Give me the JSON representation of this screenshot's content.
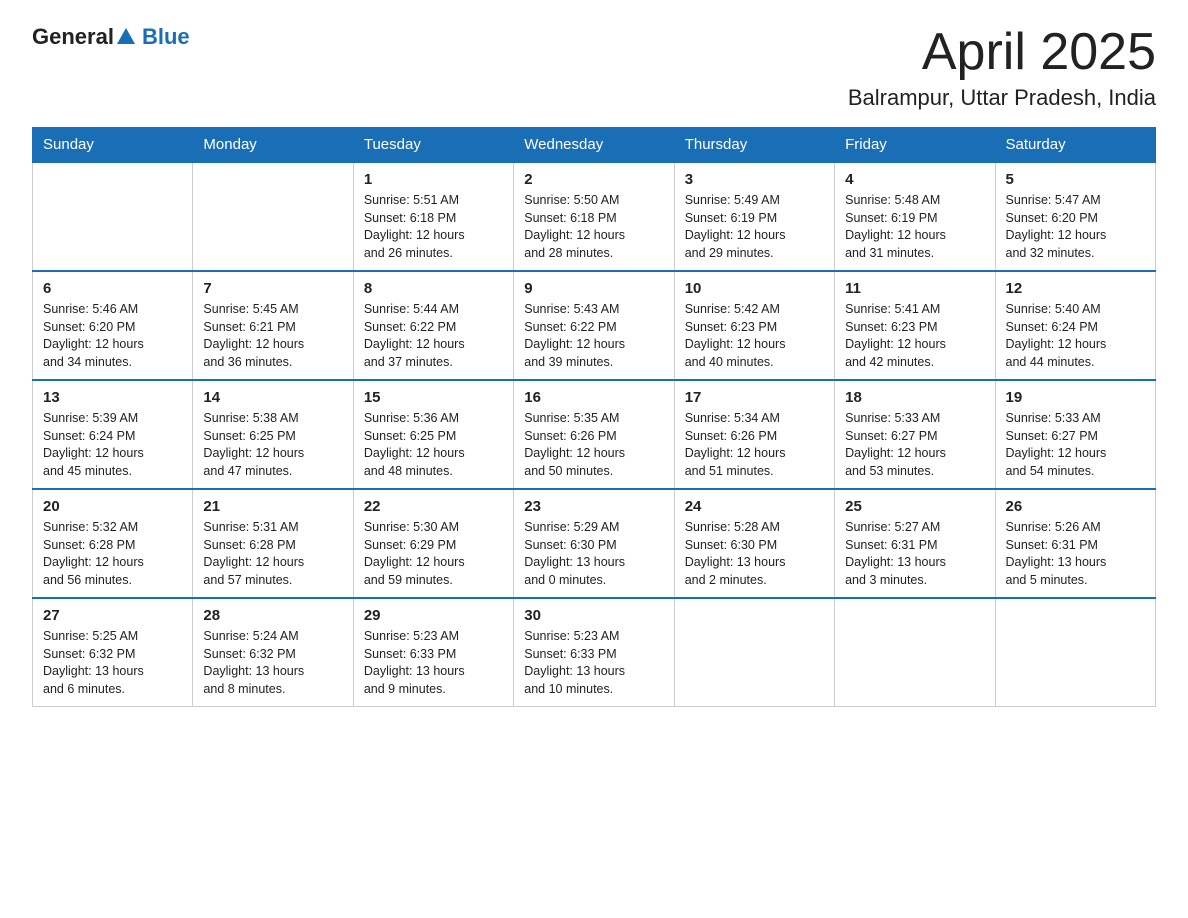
{
  "header": {
    "logo_general": "General",
    "logo_blue": "Blue",
    "month_title": "April 2025",
    "location": "Balrampur, Uttar Pradesh, India"
  },
  "weekdays": [
    "Sunday",
    "Monday",
    "Tuesday",
    "Wednesday",
    "Thursday",
    "Friday",
    "Saturday"
  ],
  "weeks": [
    [
      {
        "day": "",
        "info": ""
      },
      {
        "day": "",
        "info": ""
      },
      {
        "day": "1",
        "info": "Sunrise: 5:51 AM\nSunset: 6:18 PM\nDaylight: 12 hours\nand 26 minutes."
      },
      {
        "day": "2",
        "info": "Sunrise: 5:50 AM\nSunset: 6:18 PM\nDaylight: 12 hours\nand 28 minutes."
      },
      {
        "day": "3",
        "info": "Sunrise: 5:49 AM\nSunset: 6:19 PM\nDaylight: 12 hours\nand 29 minutes."
      },
      {
        "day": "4",
        "info": "Sunrise: 5:48 AM\nSunset: 6:19 PM\nDaylight: 12 hours\nand 31 minutes."
      },
      {
        "day": "5",
        "info": "Sunrise: 5:47 AM\nSunset: 6:20 PM\nDaylight: 12 hours\nand 32 minutes."
      }
    ],
    [
      {
        "day": "6",
        "info": "Sunrise: 5:46 AM\nSunset: 6:20 PM\nDaylight: 12 hours\nand 34 minutes."
      },
      {
        "day": "7",
        "info": "Sunrise: 5:45 AM\nSunset: 6:21 PM\nDaylight: 12 hours\nand 36 minutes."
      },
      {
        "day": "8",
        "info": "Sunrise: 5:44 AM\nSunset: 6:22 PM\nDaylight: 12 hours\nand 37 minutes."
      },
      {
        "day": "9",
        "info": "Sunrise: 5:43 AM\nSunset: 6:22 PM\nDaylight: 12 hours\nand 39 minutes."
      },
      {
        "day": "10",
        "info": "Sunrise: 5:42 AM\nSunset: 6:23 PM\nDaylight: 12 hours\nand 40 minutes."
      },
      {
        "day": "11",
        "info": "Sunrise: 5:41 AM\nSunset: 6:23 PM\nDaylight: 12 hours\nand 42 minutes."
      },
      {
        "day": "12",
        "info": "Sunrise: 5:40 AM\nSunset: 6:24 PM\nDaylight: 12 hours\nand 44 minutes."
      }
    ],
    [
      {
        "day": "13",
        "info": "Sunrise: 5:39 AM\nSunset: 6:24 PM\nDaylight: 12 hours\nand 45 minutes."
      },
      {
        "day": "14",
        "info": "Sunrise: 5:38 AM\nSunset: 6:25 PM\nDaylight: 12 hours\nand 47 minutes."
      },
      {
        "day": "15",
        "info": "Sunrise: 5:36 AM\nSunset: 6:25 PM\nDaylight: 12 hours\nand 48 minutes."
      },
      {
        "day": "16",
        "info": "Sunrise: 5:35 AM\nSunset: 6:26 PM\nDaylight: 12 hours\nand 50 minutes."
      },
      {
        "day": "17",
        "info": "Sunrise: 5:34 AM\nSunset: 6:26 PM\nDaylight: 12 hours\nand 51 minutes."
      },
      {
        "day": "18",
        "info": "Sunrise: 5:33 AM\nSunset: 6:27 PM\nDaylight: 12 hours\nand 53 minutes."
      },
      {
        "day": "19",
        "info": "Sunrise: 5:33 AM\nSunset: 6:27 PM\nDaylight: 12 hours\nand 54 minutes."
      }
    ],
    [
      {
        "day": "20",
        "info": "Sunrise: 5:32 AM\nSunset: 6:28 PM\nDaylight: 12 hours\nand 56 minutes."
      },
      {
        "day": "21",
        "info": "Sunrise: 5:31 AM\nSunset: 6:28 PM\nDaylight: 12 hours\nand 57 minutes."
      },
      {
        "day": "22",
        "info": "Sunrise: 5:30 AM\nSunset: 6:29 PM\nDaylight: 12 hours\nand 59 minutes."
      },
      {
        "day": "23",
        "info": "Sunrise: 5:29 AM\nSunset: 6:30 PM\nDaylight: 13 hours\nand 0 minutes."
      },
      {
        "day": "24",
        "info": "Sunrise: 5:28 AM\nSunset: 6:30 PM\nDaylight: 13 hours\nand 2 minutes."
      },
      {
        "day": "25",
        "info": "Sunrise: 5:27 AM\nSunset: 6:31 PM\nDaylight: 13 hours\nand 3 minutes."
      },
      {
        "day": "26",
        "info": "Sunrise: 5:26 AM\nSunset: 6:31 PM\nDaylight: 13 hours\nand 5 minutes."
      }
    ],
    [
      {
        "day": "27",
        "info": "Sunrise: 5:25 AM\nSunset: 6:32 PM\nDaylight: 13 hours\nand 6 minutes."
      },
      {
        "day": "28",
        "info": "Sunrise: 5:24 AM\nSunset: 6:32 PM\nDaylight: 13 hours\nand 8 minutes."
      },
      {
        "day": "29",
        "info": "Sunrise: 5:23 AM\nSunset: 6:33 PM\nDaylight: 13 hours\nand 9 minutes."
      },
      {
        "day": "30",
        "info": "Sunrise: 5:23 AM\nSunset: 6:33 PM\nDaylight: 13 hours\nand 10 minutes."
      },
      {
        "day": "",
        "info": ""
      },
      {
        "day": "",
        "info": ""
      },
      {
        "day": "",
        "info": ""
      }
    ]
  ]
}
